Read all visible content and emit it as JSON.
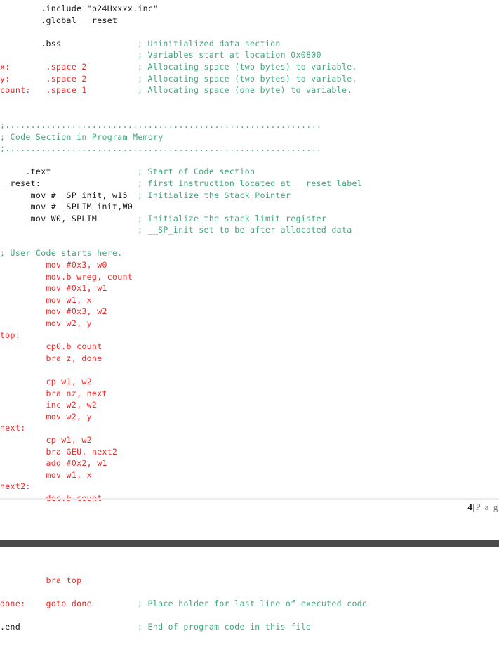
{
  "document": {
    "type": "assembly-code-listing",
    "colors": {
      "directive": "#1a1a1a",
      "label_instruction": "#f72626",
      "comment": "#3fa87c",
      "page_break_bar": "#4b4b4b",
      "footer_rule": "#ececec",
      "background": "#ffffff"
    }
  },
  "footer": {
    "page_number": "4",
    "separator": "|",
    "page_word": "P a g"
  },
  "top_block": {
    "lines": [
      {
        "code": "        .include \"p24Hxxxx.inc\"",
        "code_color": "black",
        "comment": "",
        "comment_color": "green"
      },
      {
        "code": "        .global __reset",
        "code_color": "black",
        "comment": "",
        "comment_color": "green"
      },
      {
        "code": "",
        "code_color": "black",
        "comment": "",
        "comment_color": "green"
      },
      {
        "code": "        .bss",
        "code_color": "black",
        "comment": "; Uninitialized data section",
        "comment_color": "green"
      },
      {
        "code": "",
        "code_color": "black",
        "comment": "; Variables start at location 0x0800",
        "comment_color": "green"
      },
      {
        "code": "x:       .space 2",
        "code_color": "red",
        "comment": "; Allocating space (two bytes) to variable.",
        "comment_color": "green"
      },
      {
        "code": "y:       .space 2",
        "code_color": "red",
        "comment": "; Allocating space (two bytes) to variable.",
        "comment_color": "green"
      },
      {
        "code": "count:   .space 1",
        "code_color": "red",
        "comment": "; Allocating space (one byte) to variable.",
        "comment_color": "green"
      },
      {
        "code": "",
        "code_color": "black",
        "comment": "",
        "comment_color": "green"
      },
      {
        "code": "",
        "code_color": "black",
        "comment": "",
        "comment_color": "green"
      },
      {
        "separator": ";.............................................................."
      },
      {
        "code": "",
        "code_color": "black",
        "comment": "; Code Section in Program Memory",
        "comment_color": "green",
        "comment_flush": true
      },
      {
        "separator": ";.............................................................."
      },
      {
        "code": "",
        "code_color": "black",
        "comment": "",
        "comment_color": "green"
      },
      {
        "code": "     .text",
        "code_color": "black",
        "comment": "; Start of Code section",
        "comment_color": "green"
      },
      {
        "code": "__reset:",
        "code_color": "black",
        "comment": "; first instruction located at __reset label",
        "comment_color": "green"
      },
      {
        "code": "      mov #__SP_init, w15",
        "code_color": "black",
        "comment": "; Initialize the Stack Pointer",
        "comment_color": "green"
      },
      {
        "code": "      mov #__SPLIM_init,W0",
        "code_color": "black",
        "comment": "",
        "comment_color": "green"
      },
      {
        "code": "      mov W0, SPLIM",
        "code_color": "black",
        "comment": "; Initialize the stack limit register",
        "comment_color": "green"
      },
      {
        "code": "",
        "code_color": "black",
        "comment": "; __SP_init set to be after allocated data",
        "comment_color": "green"
      },
      {
        "code": "",
        "code_color": "black",
        "comment": "",
        "comment_color": "green"
      },
      {
        "code": "",
        "code_color": "black",
        "comment": "; User Code starts here.",
        "comment_color": "green",
        "comment_flush": true
      },
      {
        "code": "         mov #0x3, w0",
        "code_color": "red",
        "comment": "",
        "comment_color": "green"
      },
      {
        "code": "         mov.b wreg, count",
        "code_color": "red",
        "comment": "",
        "comment_color": "green"
      },
      {
        "code": "         mov #0x1, w1",
        "code_color": "red",
        "comment": "",
        "comment_color": "green"
      },
      {
        "code": "         mov w1, x",
        "code_color": "red",
        "comment": "",
        "comment_color": "green"
      },
      {
        "code": "         mov #0x3, w2",
        "code_color": "red",
        "comment": "",
        "comment_color": "green"
      },
      {
        "code": "         mov w2, y",
        "code_color": "red",
        "comment": "",
        "comment_color": "green"
      },
      {
        "code": "top:",
        "code_color": "red",
        "comment": "",
        "comment_color": "green"
      },
      {
        "code": "         cp0.b count",
        "code_color": "red",
        "comment": "",
        "comment_color": "green"
      },
      {
        "code": "         bra z, done",
        "code_color": "red",
        "comment": "",
        "comment_color": "green"
      },
      {
        "code": "",
        "code_color": "red",
        "comment": "",
        "comment_color": "green"
      },
      {
        "code": "         cp w1, w2",
        "code_color": "red",
        "comment": "",
        "comment_color": "green"
      },
      {
        "code": "         bra nz, next",
        "code_color": "red",
        "comment": "",
        "comment_color": "green"
      },
      {
        "code": "         inc w2, w2",
        "code_color": "red",
        "comment": "",
        "comment_color": "green"
      },
      {
        "code": "         mov w2, y",
        "code_color": "red",
        "comment": "",
        "comment_color": "green"
      },
      {
        "code": "next:",
        "code_color": "red",
        "comment": "",
        "comment_color": "green"
      },
      {
        "code": "         cp w1, w2",
        "code_color": "red",
        "comment": "",
        "comment_color": "green"
      },
      {
        "code": "         bra GEU, next2",
        "code_color": "red",
        "comment": "",
        "comment_color": "green"
      },
      {
        "code": "         add #0x2, w1",
        "code_color": "red",
        "comment": "",
        "comment_color": "green"
      },
      {
        "code": "         mov w1, x",
        "code_color": "red",
        "comment": "",
        "comment_color": "green"
      },
      {
        "code": "next2:",
        "code_color": "red",
        "comment": "",
        "comment_color": "green"
      },
      {
        "code": "         dec.b count",
        "code_color": "red",
        "comment": "",
        "comment_color": "green"
      }
    ]
  },
  "bottom_block": {
    "lines": [
      {
        "code": "         bra top",
        "code_color": "red",
        "comment": "",
        "comment_color": "green"
      },
      {
        "code": "done:    goto done",
        "code_color": "red",
        "comment": "; Place holder for last line of executed code",
        "comment_color": "green"
      },
      {
        "code": ".end",
        "code_color": "black",
        "comment": "; End of program code in this file",
        "comment_color": "green"
      }
    ]
  }
}
